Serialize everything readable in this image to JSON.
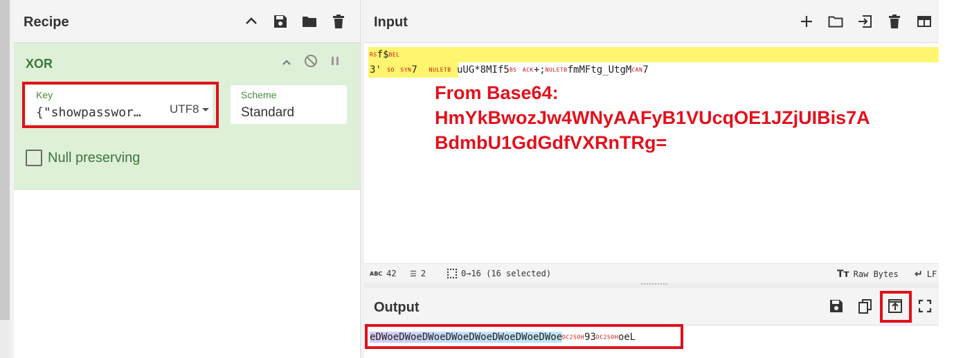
{
  "recipe": {
    "title": "Recipe",
    "icons": [
      "chevron-up-icon",
      "save-icon",
      "folder-icon",
      "trash-icon"
    ]
  },
  "operation": {
    "name": "XOR",
    "key_label": "Key",
    "key_value": "{\"showpasswor…",
    "key_encoding": "UTF8",
    "scheme_label": "Scheme",
    "scheme_value": "Standard",
    "null_preserving_label": "Null preserving"
  },
  "input": {
    "title": "Input",
    "line1": {
      "rs": "RS",
      "text": "f$",
      "bel": "BEL"
    },
    "line2": {
      "a": "3'",
      "so": "SO",
      "syn": "SYN",
      "b": "7",
      "nul": "NUL",
      "etb": "ETB",
      "c": "uUG*8MIf5",
      "bs": "BS",
      "ack": "ACK",
      "d": "+;",
      "nul2": "NUL",
      "etb2": "ETB",
      "e": "fmMFtg_UtgM",
      "can": "CAN",
      "f": "7"
    },
    "annotation": [
      "From Base64:",
      "HmYkBwozJw4WNyAAFyB1VUcqOE1JZjUIBis7A",
      "BdmbU1GdGdfVXRnTRg="
    ]
  },
  "status": {
    "length_icon": "ABC",
    "length": "42",
    "lines": "2",
    "selection": "0→16 (16 selected)",
    "raw_bytes": "Raw Bytes",
    "eol": "LF"
  },
  "output": {
    "title": "Output",
    "highlighted": "eDWoeDWoeDWoeDWoeDWoeDWoeDWoeDWoe",
    "dc2": "DC2",
    "soh": "SOH",
    "mid": "93",
    "dc2b": "DC2",
    "sohb": "SOH",
    "tail": "oeL"
  },
  "colors": {
    "accent_red": "#e0101b",
    "op_bg": "#dff0d8",
    "op_text": "#3c763d",
    "highlight_yellow": "#fff56e"
  }
}
